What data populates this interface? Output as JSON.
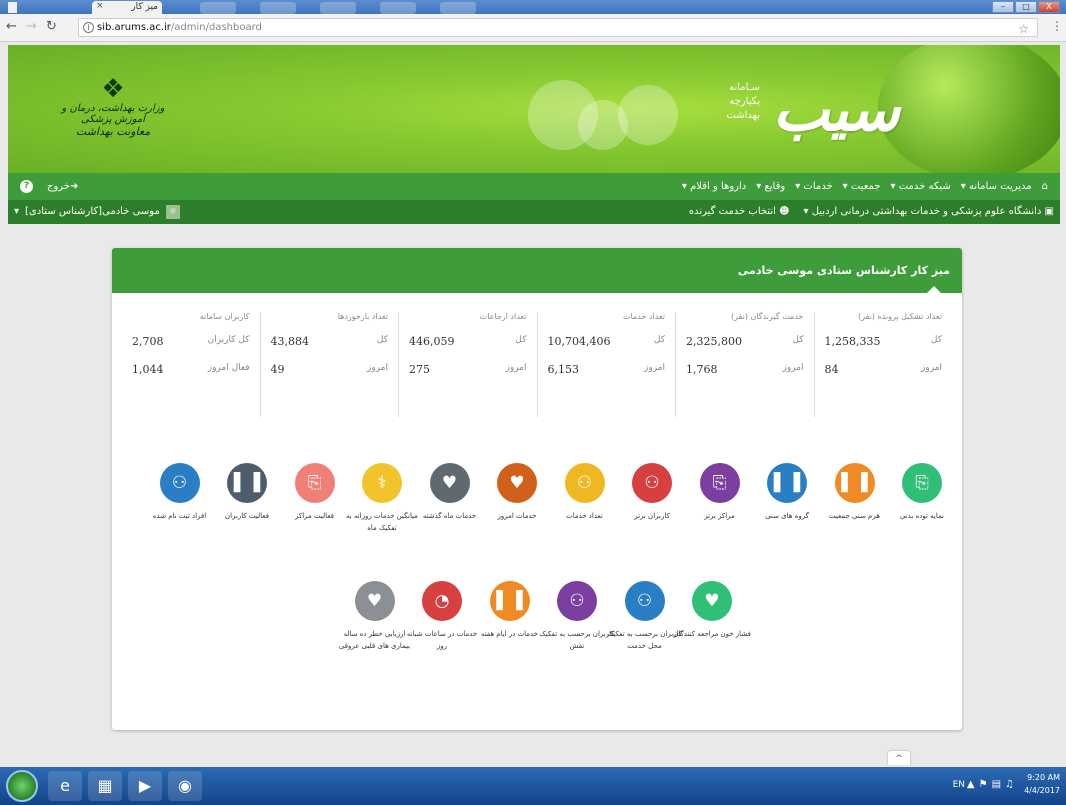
{
  "browser": {
    "tab_title": "میز کار",
    "tab_close": "×",
    "url_domain": "sib.arums.ac.ir",
    "url_path": "/admin/dashboard",
    "win_buttons": [
      "–",
      "□",
      "X"
    ]
  },
  "banner": {
    "brand": "سیب",
    "brand_sub_lines": [
      "سـامانه",
      "یکپارچه",
      "بهداشت"
    ],
    "ministry_l1": "وزارت بهداشت، درمان و آموزش پزشکی",
    "ministry_l2": "معاونت بهداشت"
  },
  "mainnav": {
    "items": [
      "مدیریت سامانه",
      "شبکه خدمت",
      "جمعیت",
      "خدمات",
      "وقایع",
      "داروها و اقلام"
    ],
    "logout": "خروج",
    "help": "?"
  },
  "subnav": {
    "university": "دانشگاه علوم پزشکی و خدمات بهداشتی درمانی اردبیل",
    "select_recipient": "انتخاب خدمت گیرنده",
    "user_role": "موسی خادمی[کارشناس ستادی]"
  },
  "panel": {
    "title": "میز کار کارشناس ستادی موسی خادمی",
    "stats": [
      {
        "header": "تعداد تشکیل پرونده (نفر)",
        "r1_label": "کل",
        "r1_value": "1,258,335",
        "r2_label": "امروز",
        "r2_value": "84"
      },
      {
        "header": "خدمت گیرندگان (نفر)",
        "r1_label": "کل",
        "r1_value": "2,325,800",
        "r2_label": "امروز",
        "r2_value": "1,768"
      },
      {
        "header": "تعداد خدمات",
        "r1_label": "کل",
        "r1_value": "10,704,406",
        "r2_label": "امروز",
        "r2_value": "6,153"
      },
      {
        "header": "تعداد ارجاعات",
        "r1_label": "کل",
        "r1_value": "446,059",
        "r2_label": "امروز",
        "r2_value": "275"
      },
      {
        "header": "تعداد بازخوردها",
        "r1_label": "کل",
        "r1_value": "43,884",
        "r2_label": "امروز",
        "r2_value": "49"
      },
      {
        "header": "کاربران سامانه",
        "r1_label": "کل کاربران",
        "r1_value": "2,708",
        "r2_label": "فعال امروز",
        "r2_value": "1,044"
      }
    ],
    "icons_row1": [
      {
        "label": "نمایه توده بدنی",
        "color": "#2fbf77",
        "glyph": "clipboard-icon"
      },
      {
        "label": "هرم سنی جمعیت",
        "color": "#f08a24",
        "glyph": "bar-chart-icon"
      },
      {
        "label": "گروه های سنی",
        "color": "#2a7fc4",
        "glyph": "bar-chart-icon"
      },
      {
        "label": "مراکز برتر",
        "color": "#7b3fa0",
        "glyph": "clipboard-icon"
      },
      {
        "label": "کاربران برتر",
        "color": "#d64040",
        "glyph": "users-icon"
      },
      {
        "label": "تعداد خدمات",
        "color": "#f0b820",
        "glyph": "users-icon"
      },
      {
        "label": "خدمات امروز",
        "color": "#d0601a",
        "glyph": "heart-icon"
      },
      {
        "label": "خدمات ماه گذشته",
        "color": "#5f6a70",
        "glyph": "heart-icon"
      },
      {
        "label": "میانگین خدمات روزانه به تفکیک ماه",
        "color": "#f2c32a",
        "glyph": "stethoscope-icon"
      },
      {
        "label": "فعالیت مراکز",
        "color": "#f08075",
        "glyph": "clipboard-icon"
      },
      {
        "label": "فعالیت کاربران",
        "color": "#4d5d6c",
        "glyph": "bar-chart-icon"
      },
      {
        "label": "افراد ثبت نام شده",
        "color": "#2a7fc4",
        "glyph": "users-icon"
      }
    ],
    "icons_row2": [
      {
        "label": "فشار خون مراجعه کنندگان",
        "color": "#2fbf77",
        "glyph": "heart-icon"
      },
      {
        "label": "کاربران برحسب به تفکیک محل خدمت",
        "color": "#2a7fc4",
        "glyph": "users-icon"
      },
      {
        "label": "کاربران برحسب به تفکیک نقش",
        "color": "#7b3fa0",
        "glyph": "users-icon"
      },
      {
        "label": "خدمات در ایام هفته",
        "color": "#f08a24",
        "glyph": "bar-chart-icon"
      },
      {
        "label": "خدمات در ساعات شبانه روز",
        "color": "#d64040",
        "glyph": "pie-chart-icon"
      },
      {
        "label": "ارزیابی خطر ده ساله بیماری های قلبی عروقی",
        "color": "#8a9096",
        "glyph": "heart-icon"
      }
    ],
    "scroll_up": "^"
  },
  "taskbar": {
    "lang": "EN",
    "time": "9:20 AM",
    "date": "4/4/2017"
  }
}
